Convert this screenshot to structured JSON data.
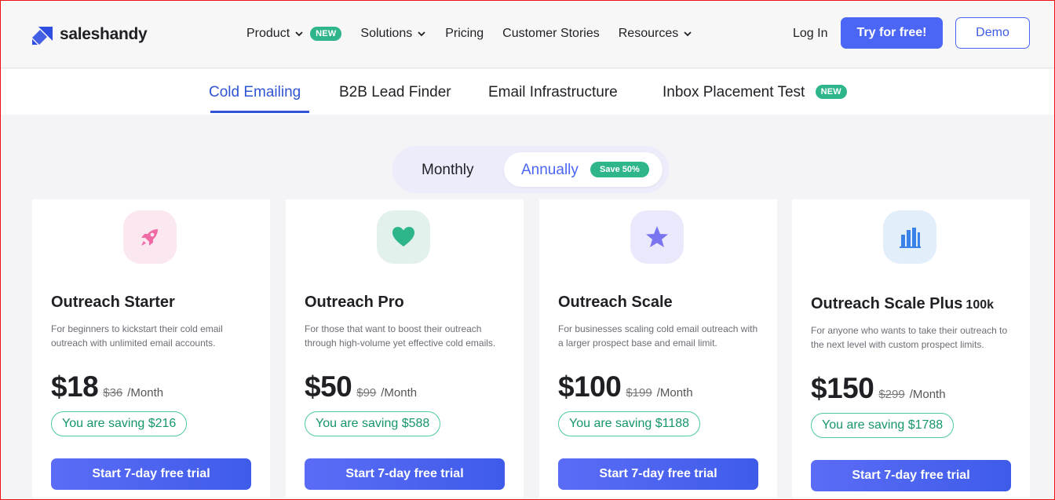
{
  "brand": {
    "name": "saleshandy",
    "color": "#2f4ee0"
  },
  "nav": {
    "items": [
      {
        "label": "Product",
        "has_dropdown": true,
        "badge": "NEW"
      },
      {
        "label": "Solutions",
        "has_dropdown": true,
        "badge": ""
      },
      {
        "label": "Pricing",
        "has_dropdown": false,
        "badge": ""
      },
      {
        "label": "Customer Stories",
        "has_dropdown": false,
        "badge": ""
      },
      {
        "label": "Resources",
        "has_dropdown": true,
        "badge": ""
      }
    ],
    "login": "Log In",
    "try_free": "Try for free!",
    "demo": "Demo"
  },
  "product_tabs": {
    "items": [
      {
        "label": "Cold Emailing",
        "active": true
      },
      {
        "label": "B2B Lead Finder",
        "active": false
      },
      {
        "label": "Email Infrastructure",
        "active": false
      },
      {
        "label": "Inbox Placement Test",
        "active": false,
        "badge": "NEW"
      }
    ]
  },
  "billing_toggle": {
    "monthly": "Monthly",
    "annually": "Annually",
    "save_badge": "Save 50%",
    "selected": "annually"
  },
  "plans": [
    {
      "icon": "rocket-icon",
      "icon_color": "#f06aa6",
      "name": "Outreach Starter",
      "name_suffix": "",
      "desc": "For beginners to kickstart their cold email outreach with unlimited email accounts.",
      "price": "$18",
      "old_price": "$36",
      "per": "/Month",
      "saving": "You are saving $216",
      "cta": "Start 7-day free trial"
    },
    {
      "icon": "heart-icon",
      "icon_color": "#2fb58c",
      "name": "Outreach Pro",
      "name_suffix": "",
      "desc": "For those that want to boost their outreach through high-volume yet effective cold emails.",
      "price": "$50",
      "old_price": "$99",
      "per": "/Month",
      "saving": "You are saving $588",
      "cta": "Start 7-day free trial"
    },
    {
      "icon": "star-icon",
      "icon_color": "#7b74f0",
      "name": "Outreach Scale",
      "name_suffix": "",
      "desc": "For businesses scaling cold email outreach with a larger prospect base and email limit.",
      "price": "$100",
      "old_price": "$199",
      "per": "/Month",
      "saving": "You are saving $1188",
      "cta": "Start 7-day free trial"
    },
    {
      "icon": "bar-chart-icon",
      "icon_color": "#3a82e8",
      "name": "Outreach Scale Plus",
      "name_suffix": "100k",
      "desc": "For anyone who wants to take their outreach to the next level with custom prospect limits.",
      "price": "$150",
      "old_price": "$299",
      "per": "/Month",
      "saving": "You are saving $1788",
      "cta": "Start 7-day free trial"
    }
  ]
}
